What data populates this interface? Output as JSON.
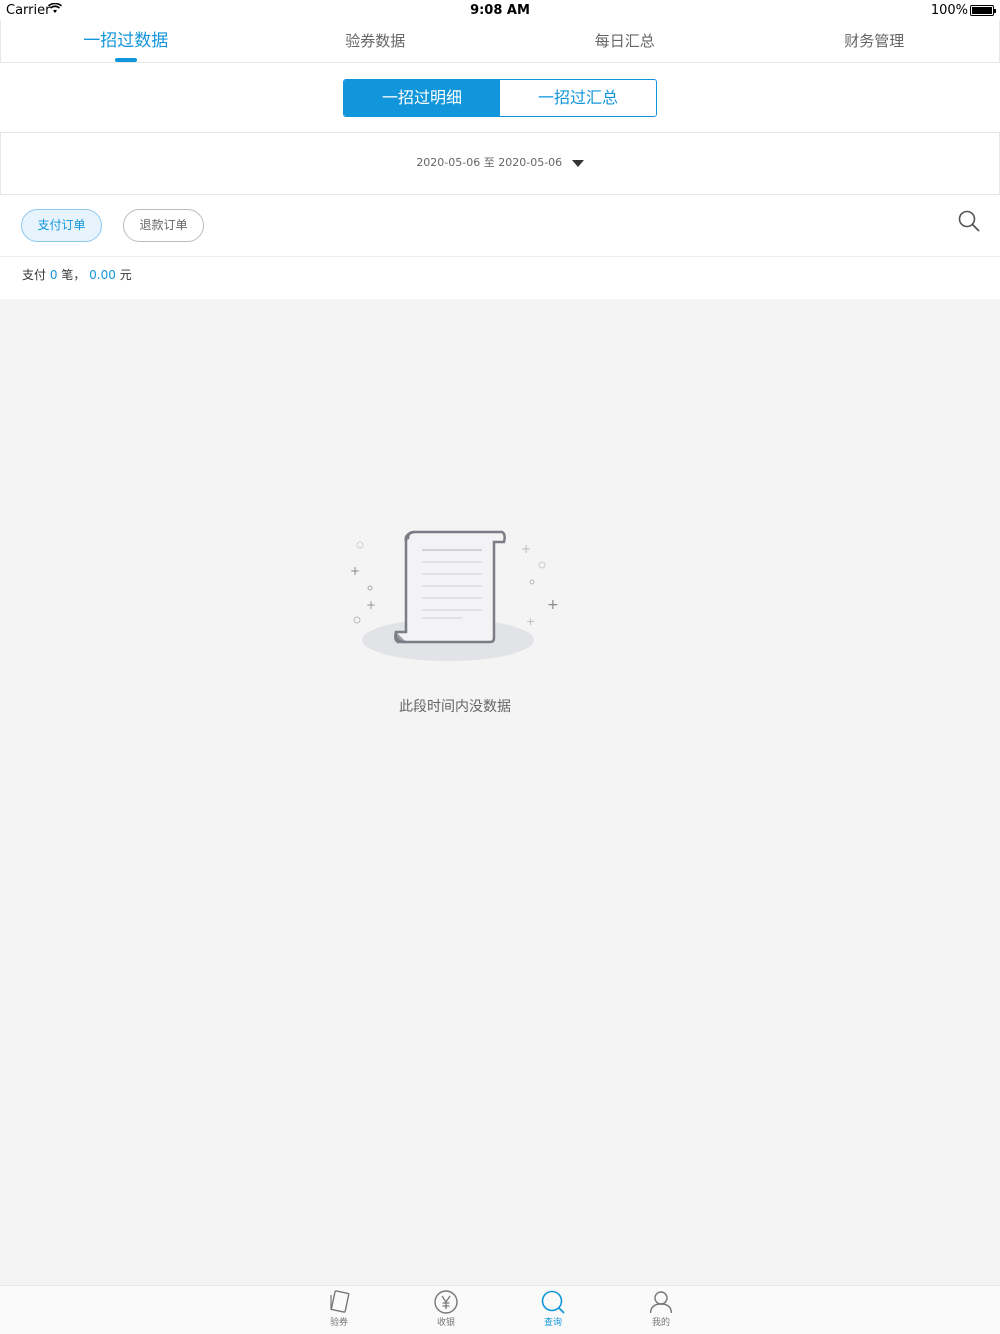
{
  "status_bar": {
    "carrier": "Carrier",
    "time": "9:08 AM",
    "battery": "100%"
  },
  "top_tabs": [
    {
      "label": "一招过数据",
      "active": true
    },
    {
      "label": "验券数据",
      "active": false
    },
    {
      "label": "每日汇总",
      "active": false
    },
    {
      "label": "财务管理",
      "active": false
    }
  ],
  "segmented": [
    {
      "label": "一招过明细",
      "active": true
    },
    {
      "label": "一招过汇总",
      "active": false
    }
  ],
  "date_range": {
    "start": "2020-05-06",
    "separator": "至",
    "end": "2020-05-06"
  },
  "filters": {
    "pay": "支付订单",
    "refund": "退款订单"
  },
  "summary": {
    "prefix": "支付",
    "count": "0",
    "count_unit": "笔，",
    "amount": "0.00",
    "amount_unit": "元"
  },
  "empty_state": {
    "message": "此段时间内没数据"
  },
  "tab_bar": [
    {
      "label": "验券",
      "icon": "ticket-icon"
    },
    {
      "label": "收银",
      "icon": "yen-icon"
    },
    {
      "label": "查询",
      "icon": "search-icon"
    },
    {
      "label": "我的",
      "icon": "user-icon"
    }
  ],
  "colors": {
    "accent": "#1296db",
    "background": "#f4f4f4"
  }
}
